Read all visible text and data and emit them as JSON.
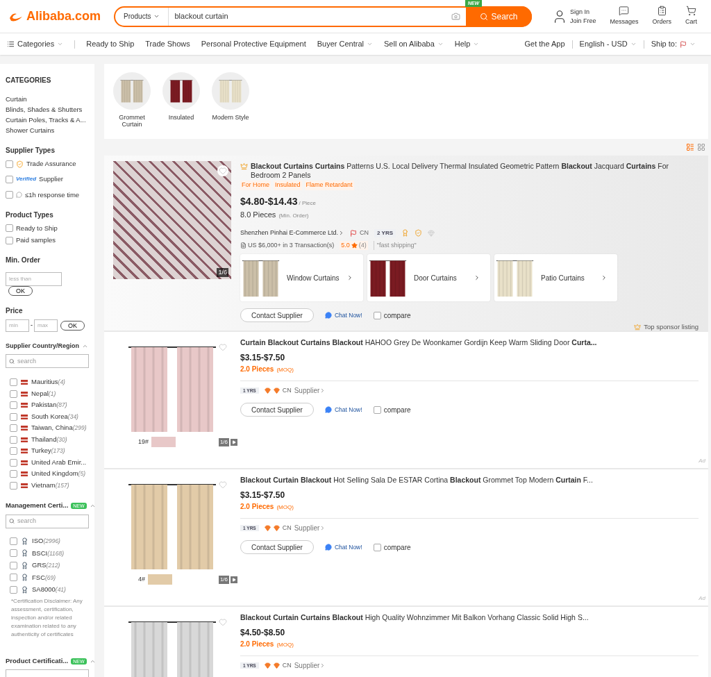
{
  "header": {
    "logo": "Alibaba.com",
    "search": {
      "category": "Products",
      "value": "blackout curtain",
      "badge": "NEW",
      "button": "Search"
    },
    "account": {
      "sign_in": "Sign In",
      "join": "Join Free"
    },
    "actions": [
      {
        "kind": "messages",
        "label": "Messages"
      },
      {
        "kind": "orders",
        "label": "Orders"
      },
      {
        "kind": "cart",
        "label": "Cart"
      }
    ]
  },
  "nav": {
    "left": [
      {
        "label": "Categories",
        "kind": "menu",
        "dropdown": true
      },
      {
        "label": "Ready to Ship",
        "dropdown": false
      },
      {
        "label": "Trade Shows",
        "dropdown": false
      },
      {
        "label": "Personal Protective Equipment",
        "dropdown": false
      },
      {
        "label": "Buyer Central",
        "dropdown": true
      },
      {
        "label": "Sell on Alibaba",
        "dropdown": true
      },
      {
        "label": "Help",
        "dropdown": true
      }
    ],
    "right": [
      {
        "label": "Get the App",
        "dropdown": false
      },
      {
        "label": "English - USD",
        "dropdown": true
      },
      {
        "label": "Ship to:",
        "kind": "flag",
        "dropdown": true
      }
    ]
  },
  "sidebar": {
    "categories": {
      "title": "CATEGORIES",
      "items": [
        "Curtain",
        "Blinds, Shades & Shutters",
        "Curtain Poles, Tracks & A...",
        "Shower Curtains"
      ]
    },
    "supplier_types": {
      "title": "Supplier Types",
      "options": [
        {
          "kind": "trade-assurance",
          "label": "Trade Assurance",
          "checked": false
        },
        {
          "kind": "verified",
          "badge": "Verified",
          "label": "Supplier",
          "checked": false
        },
        {
          "kind": "response",
          "label": "≤1h response time",
          "checked": false
        }
      ]
    },
    "product_types": {
      "title": "Product Types",
      "options": [
        {
          "label": "Ready to Ship",
          "checked": false
        },
        {
          "label": "Paid samples",
          "checked": false
        }
      ]
    },
    "min_order": {
      "title": "Min. Order",
      "placeholder": "less than",
      "button": "OK"
    },
    "price": {
      "title": "Price",
      "min_placeholder": "min",
      "separator": "-",
      "max_placeholder": "max",
      "button": "OK"
    },
    "country": {
      "title": "Supplier Country/Region",
      "expanded": true,
      "search_placeholder": "search",
      "items": [
        {
          "name": "Mauritius",
          "count": "(4)",
          "checked": false
        },
        {
          "name": "Nepal",
          "count": "(1)",
          "checked": false
        },
        {
          "name": "Pakistan",
          "count": "(87)",
          "checked": false
        },
        {
          "name": "South Korea",
          "count": "(34)",
          "checked": false
        },
        {
          "name": "Taiwan, China",
          "count": "(299)",
          "checked": false
        },
        {
          "name": "Thailand",
          "count": "(30)",
          "checked": false
        },
        {
          "name": "Turkey",
          "count": "(173)",
          "checked": false
        },
        {
          "name": "United Arab Emir...",
          "checked": false
        },
        {
          "name": "United Kingdom",
          "count": "(5)",
          "checked": false
        },
        {
          "name": "Vietnam",
          "count": "(157)",
          "checked": false
        }
      ]
    },
    "management_cert": {
      "title": "Management Certi...",
      "badge": "NEW",
      "expanded": true,
      "search_placeholder": "search",
      "items": [
        {
          "name": "ISO",
          "count": "(2996)",
          "checked": false
        },
        {
          "name": "BSCI",
          "count": "(1168)",
          "checked": false
        },
        {
          "name": "GRS",
          "count": "(212)",
          "checked": false
        },
        {
          "name": "FSC",
          "count": "(69)",
          "checked": false
        },
        {
          "name": "SA8000",
          "count": "(41)",
          "checked": false
        }
      ],
      "disclaimer": "*Certification Disclaimer: Any assessment, certification, inspection and/or related examination related to any authenticity of certificates"
    },
    "product_cert": {
      "title": "Product Certificati...",
      "badge": "NEW",
      "expanded": true
    }
  },
  "chips": [
    {
      "label": "Grommet Curtain"
    },
    {
      "label": "Insulated"
    },
    {
      "label": "Modern Style"
    }
  ],
  "view_toggle": [
    {
      "kind": "list",
      "selected": true
    },
    {
      "kind": "grid",
      "selected": false
    }
  ],
  "products": [
    {
      "kind": "sponsored",
      "title": "**Blackout Curtains Curtains** Patterns U.S. Local Delivery Thermal Insulated Geometric Pattern **Blackout** Jacquard **Curtains** For Bedroom 2 Panels",
      "tags": [
        "For Home",
        "Insulated",
        "Flame Retardant"
      ],
      "price": "$4.80-$14.43",
      "unit": "/ Piece",
      "moq": "8.0 Pieces",
      "moq_note": "(Min. Order)",
      "counter": "1/6",
      "supplier": {
        "name": "Shenzhen Pinhai E-Commerce Ltd.",
        "country": "CN",
        "years": "2 YRS",
        "transactions": "US $6,000+ in 3 Transaction(s)",
        "rating": "5.0",
        "reviews": "(4)",
        "review_note": "\"fast shipping\""
      },
      "related": [
        {
          "label": "Window Curtains"
        },
        {
          "label": "Door Curtains"
        },
        {
          "label": "Patio Curtains"
        }
      ],
      "actions": {
        "contact": "Contact Supplier",
        "chat": "Chat Now!",
        "compare": "compare",
        "compare_checked": false
      },
      "footer": "Top sponsor listing"
    },
    {
      "kind": "ad",
      "title": "**Curtain Blackout Curtains Blackout** HAHOO Grey De Woonkamer Gordijn Keep Warm Sliding Door **Curta...**",
      "price": "$3.15-$7.50",
      "moq": "2.0 Pieces",
      "moq_note": "(MOQ)",
      "swatch": {
        "label": "19#",
        "color": "#e8c8c8"
      },
      "counter": "1/6",
      "supplier": {
        "years": "1 YRS",
        "country": "CN",
        "link": "Supplier"
      },
      "actions": {
        "contact": "Contact Supplier",
        "chat": "Chat Now!",
        "compare": "compare",
        "compare_checked": false
      },
      "footer": "Ad"
    },
    {
      "kind": "ad",
      "title": "**Blackout Curtain Blackout** Hot Selling Sala De ESTAR Cortina **Blackout** Grommet Top Modern **Curtain** F...",
      "price": "$3.15-$7.50",
      "moq": "2.0 Pieces",
      "moq_note": "(MOQ)",
      "swatch": {
        "label": "4#",
        "color": "#e2cba8"
      },
      "counter": "1/6",
      "supplier": {
        "years": "1 YRS",
        "country": "CN",
        "link": "Supplier"
      },
      "actions": {
        "contact": "Contact Supplier",
        "chat": "Chat Now!",
        "compare": "compare",
        "compare_checked": false
      },
      "footer": "Ad"
    },
    {
      "kind": "ad",
      "title": "**Blackout Curtain Curtains Blackout** High Quality Wohnzimmer Mit Balkon Vorhang Classic Solid High S...",
      "price": "$4.50-$8.50",
      "moq": "2.0 Pieces",
      "moq_note": "(MOQ)",
      "supplier": {
        "years": "1 YRS",
        "country": "CN",
        "link": "Supplier"
      }
    }
  ]
}
